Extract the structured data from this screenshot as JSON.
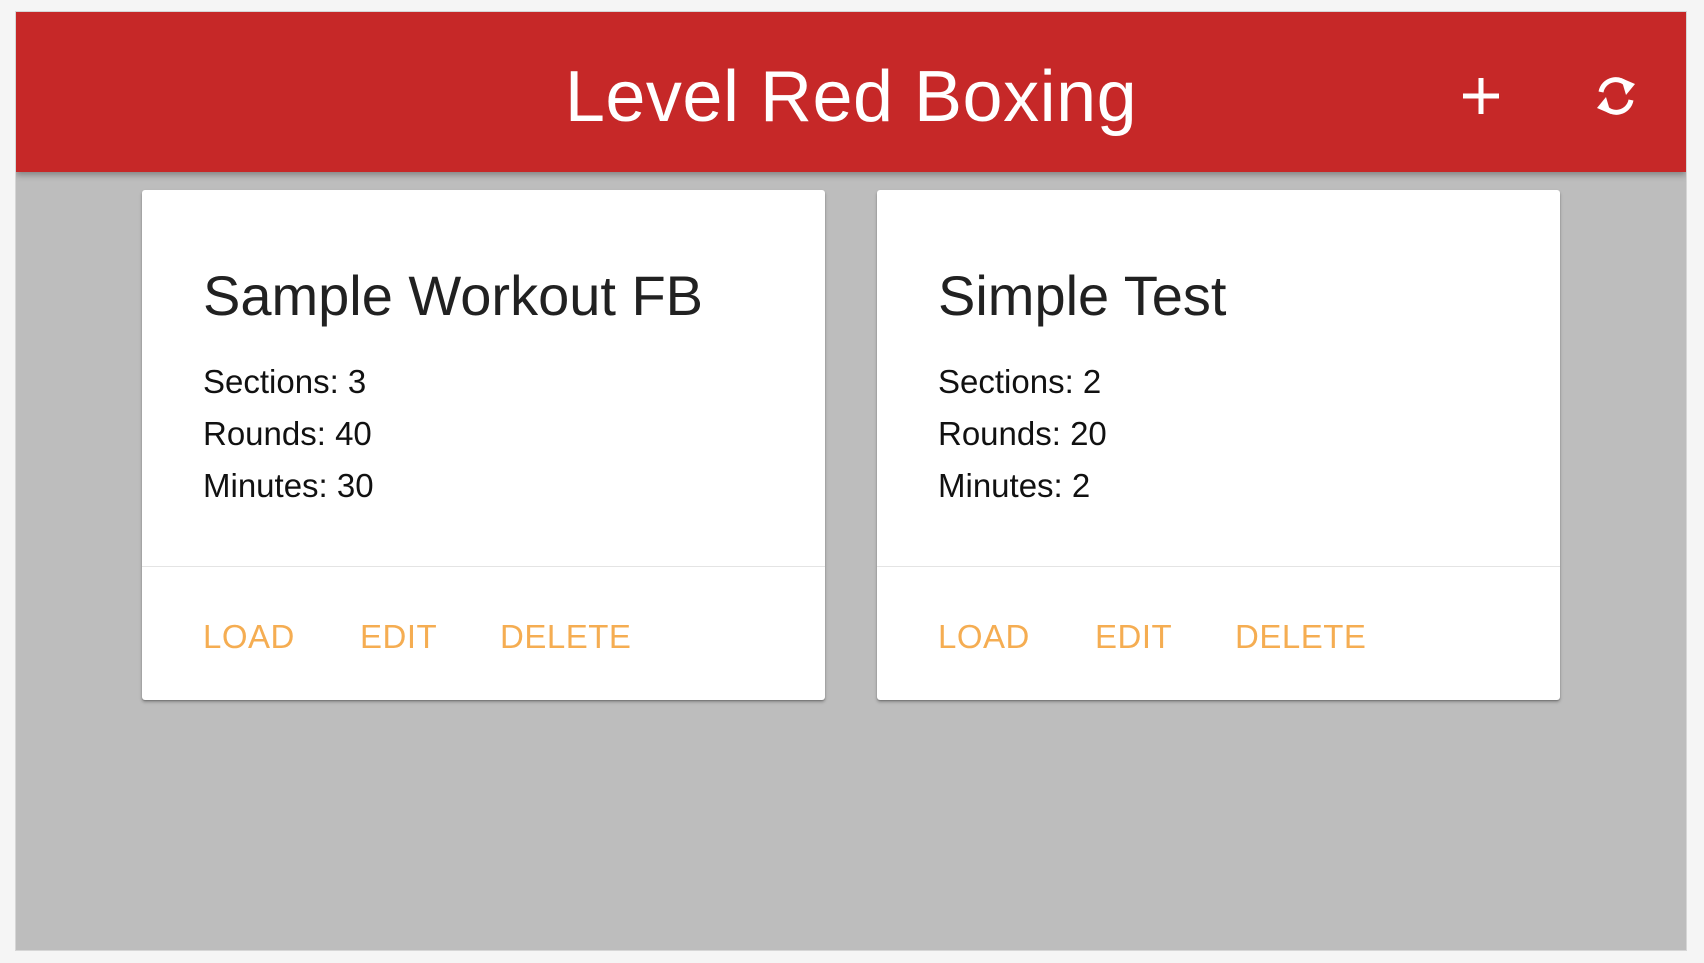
{
  "app": {
    "title": "Level Red Boxing",
    "theme_color": "#c62828",
    "accent_color": "#f5ad52",
    "header_icons": [
      "plus-icon",
      "sync-icon"
    ]
  },
  "workouts": [
    {
      "title": "Sample Workout FB",
      "sections": "Sections: 3",
      "rounds": "Rounds: 40",
      "minutes": "Minutes: 30",
      "actions": {
        "load": "LOAD",
        "edit": "EDIT",
        "delete": "DELETE"
      }
    },
    {
      "title": "Simple Test",
      "sections": "Sections: 2",
      "rounds": "Rounds: 20",
      "minutes": "Minutes: 2",
      "actions": {
        "load": "LOAD",
        "edit": "EDIT",
        "delete": "DELETE"
      }
    }
  ]
}
